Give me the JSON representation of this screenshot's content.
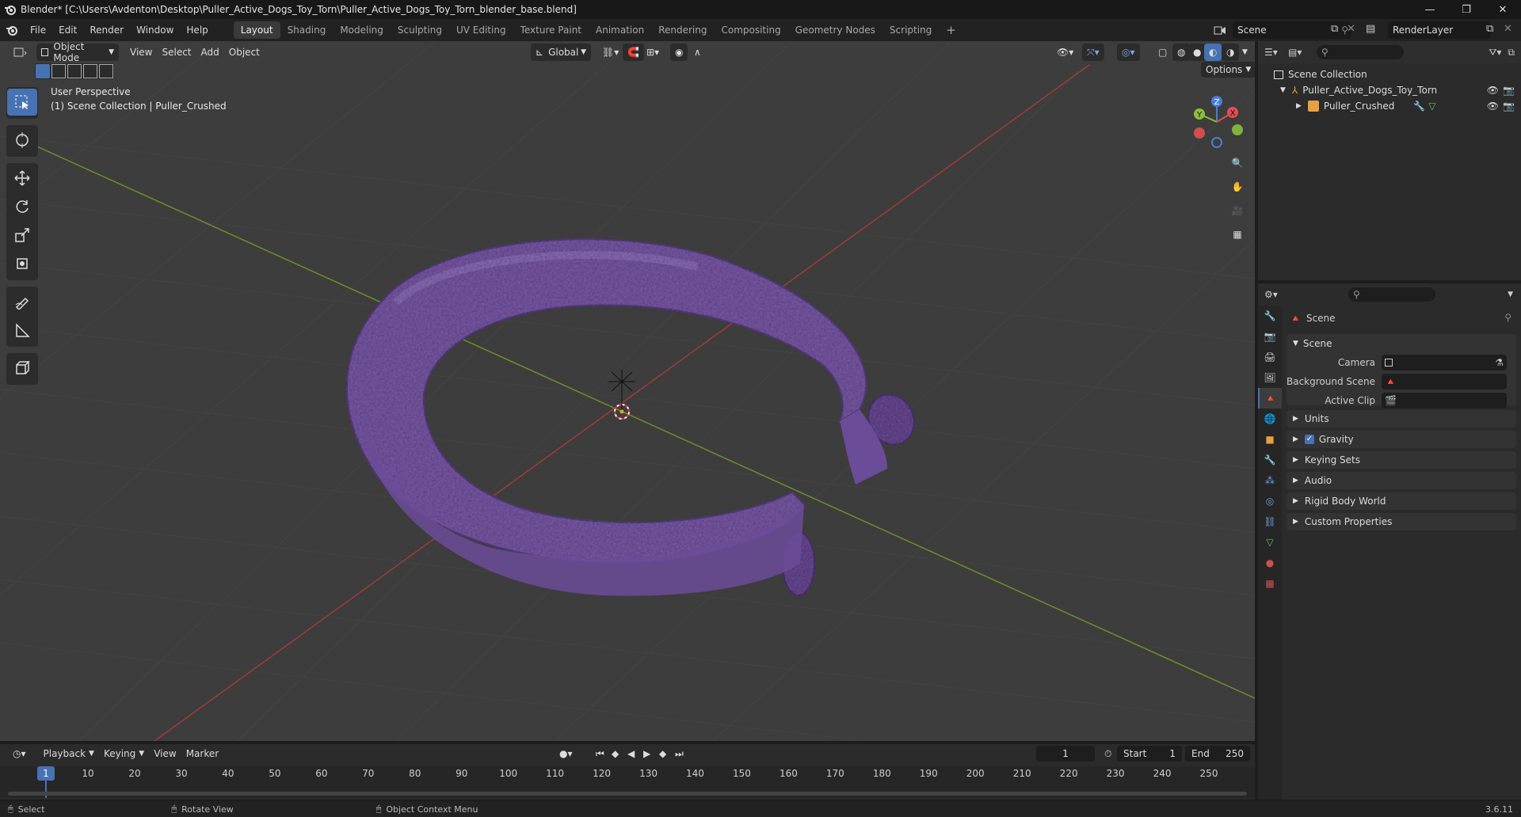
{
  "window": {
    "title": "Blender* [C:\\Users\\Avdenton\\Desktop\\Puller_Active_Dogs_Toy_Torn\\Puller_Active_Dogs_Toy_Torn_blender_base.blend]",
    "minimize": "—",
    "maximize": "❐",
    "close": "✕"
  },
  "menu": {
    "items": [
      "File",
      "Edit",
      "Render",
      "Window",
      "Help"
    ]
  },
  "workspaces": [
    "Layout",
    "Shading",
    "Modeling",
    "Sculpting",
    "UV Editing",
    "Texture Paint",
    "Animation",
    "Rendering",
    "Compositing",
    "Geometry Nodes",
    "Scripting"
  ],
  "workspace_add": "+",
  "scene_selector": {
    "value": "Scene"
  },
  "view_layer": {
    "value": "RenderLayer"
  },
  "viewport_header": {
    "mode": "Object Mode",
    "menus": [
      "View",
      "Select",
      "Add",
      "Object"
    ],
    "transform_orientation": "Global",
    "options": "Options"
  },
  "viewport": {
    "perspective": "User Perspective",
    "collection_info": "(1) Scene Collection | Puller_Crushed",
    "gizmo": {
      "z": "Z",
      "y": "Y",
      "x": "X"
    },
    "accent": "#4772b3",
    "object_color": "#7a5aa8"
  },
  "outliner": {
    "root": "Scene Collection",
    "items": [
      {
        "label": "Puller_Active_Dogs_Toy_Torn",
        "type": "collection"
      },
      {
        "label": "Puller_Crushed",
        "type": "mesh"
      }
    ]
  },
  "properties": {
    "context": "Scene",
    "scene_panel": {
      "title": "Scene",
      "camera_label": "Camera",
      "camera_value": "",
      "background_label": "Background Scene",
      "background_value": "",
      "clip_label": "Active Clip",
      "clip_value": ""
    },
    "panels": [
      "Units",
      "Gravity",
      "Keying Sets",
      "Audio",
      "Rigid Body World",
      "Custom Properties"
    ],
    "gravity_checked": true
  },
  "timeline": {
    "menus": [
      "Playback",
      "Keying",
      "View",
      "Marker"
    ],
    "current_frame": "1",
    "start_label": "Start",
    "start_value": "1",
    "end_label": "End",
    "end_value": "250",
    "ticks": [
      "1",
      "10",
      "20",
      "30",
      "40",
      "50",
      "60",
      "70",
      "80",
      "90",
      "100",
      "110",
      "120",
      "130",
      "140",
      "150",
      "160",
      "170",
      "180",
      "190",
      "200",
      "210",
      "220",
      "230",
      "240",
      "250"
    ]
  },
  "statusbar": {
    "hints": [
      "Select",
      "Rotate View",
      "Object Context Menu"
    ],
    "version": "3.6.11"
  }
}
